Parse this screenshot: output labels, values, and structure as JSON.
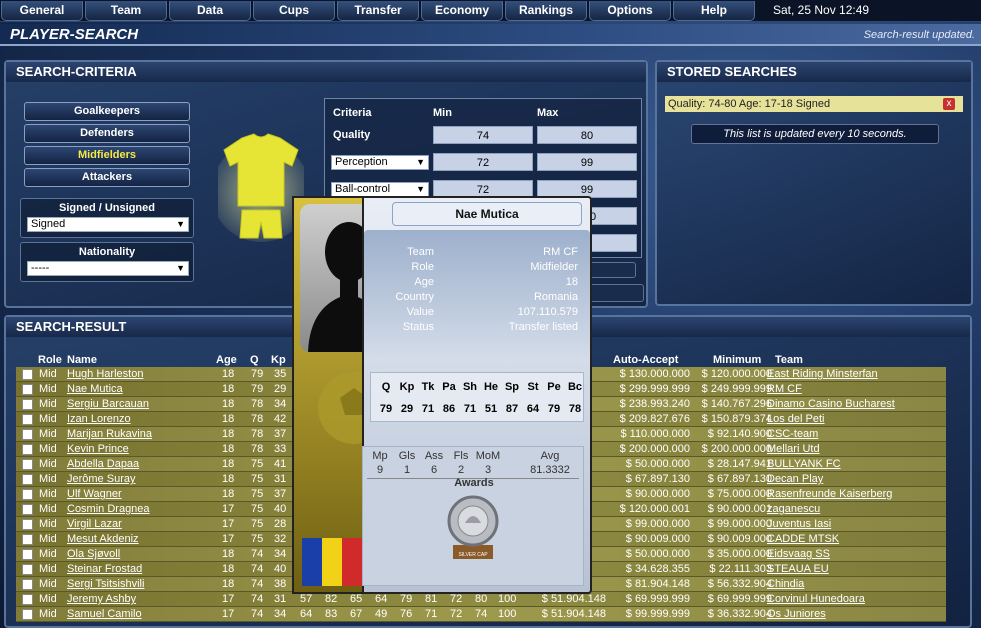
{
  "nav": {
    "items": [
      "General",
      "Team",
      "Data",
      "Cups",
      "Transfer",
      "Economy",
      "Rankings",
      "Options",
      "Help"
    ],
    "date": "Sat, 25 Nov 12:49"
  },
  "page": {
    "title": "PLAYER-SEARCH",
    "status": "Search-result updated."
  },
  "criteria": {
    "title": "SEARCH-CRITERIA",
    "positions": [
      "Goalkeepers",
      "Defenders",
      "Midfielders",
      "Attackers"
    ],
    "selected_position": "Midfielders",
    "signed_label": "Signed / Unsigned",
    "signed_value": "Signed",
    "nationality_label": "Nationality",
    "nationality_value": "-----",
    "headers": {
      "criteria": "Criteria",
      "min": "Min",
      "max": "Max"
    },
    "quality": {
      "label": "Quality",
      "min": "74",
      "max": "80"
    },
    "rows": [
      {
        "name": "Perception",
        "min": "72",
        "max": "99"
      },
      {
        "name": "Ball-control",
        "min": "72",
        "max": "99"
      }
    ],
    "hidden_value": "000"
  },
  "stored": {
    "title": "STORED SEARCHES",
    "item": "Quality: 74-80 Age: 17-18 Signed",
    "delete_icon": "x",
    "note": "This list is updated every 10 seconds."
  },
  "result": {
    "title": "SEARCH-RESULT",
    "headers": [
      "Role",
      "Name",
      "Age",
      "Q",
      "Kp",
      "Auto-Accept",
      "Minimum",
      "Team"
    ],
    "rows": [
      {
        "role": "Mid",
        "name": "Hugh Harleston",
        "age": "18",
        "q": "79",
        "kp": "35",
        "extra": [],
        "price": "",
        "auto": "$ 130.000.000",
        "min": "$ 120.000.000",
        "team": "East Riding Minsterfan"
      },
      {
        "role": "Mid",
        "name": "Nae Mutica",
        "age": "18",
        "q": "79",
        "kp": "29",
        "extra": [],
        "price": "",
        "auto": "$ 299.999.999",
        "min": "$ 249.999.999",
        "team": "RM CF"
      },
      {
        "role": "Mid",
        "name": "Sergiu Barcauan",
        "age": "18",
        "q": "78",
        "kp": "34",
        "extra": [],
        "price": "",
        "auto": "$ 238.993.240",
        "min": "$ 140.767.296",
        "team": "Dinamo Casino Bucharest"
      },
      {
        "role": "Mid",
        "name": "Izan Lorenzo",
        "age": "18",
        "q": "78",
        "kp": "42",
        "extra": [],
        "price": "",
        "auto": "$ 209.827.676",
        "min": "$ 150.879.374",
        "team": "Los del Peti"
      },
      {
        "role": "Mid",
        "name": "Marijan Rukavina",
        "age": "18",
        "q": "78",
        "kp": "37",
        "extra": [],
        "price": "",
        "auto": "$ 110.000.000",
        "min": "$ 92.140.900",
        "team": "CSC-team"
      },
      {
        "role": "Mid",
        "name": "Kevin Prince",
        "age": "18",
        "q": "78",
        "kp": "33",
        "extra": [],
        "price": "",
        "auto": "$ 200.000.000",
        "min": "$ 200.000.000",
        "team": "Mellari Utd"
      },
      {
        "role": "Mid",
        "name": "Abdella Dapaa",
        "age": "18",
        "q": "75",
        "kp": "41",
        "extra": [],
        "price": "",
        "auto": "$ 50.000.000",
        "min": "$ 28.147.941",
        "team": "BULLYANK FC"
      },
      {
        "role": "Mid",
        "name": "Jerôme Suray",
        "age": "18",
        "q": "75",
        "kp": "31",
        "extra": [],
        "price": "",
        "auto": "$ 67.897.130",
        "min": "$ 67.897.130",
        "team": "Decan Play"
      },
      {
        "role": "Mid",
        "name": "Ulf Wagner",
        "age": "18",
        "q": "75",
        "kp": "37",
        "extra": [],
        "price": "",
        "auto": "$ 90.000.000",
        "min": "$ 75.000.000",
        "team": "Rasenfreunde Kaiserberg"
      },
      {
        "role": "Mid",
        "name": "Cosmin Dragnea",
        "age": "17",
        "q": "75",
        "kp": "40",
        "extra": [],
        "price": "",
        "auto": "$ 120.000.001",
        "min": "$ 90.000.001",
        "team": "zaganescu"
      },
      {
        "role": "Mid",
        "name": "Virgil Lazar",
        "age": "17",
        "q": "75",
        "kp": "28",
        "extra": [],
        "price": "",
        "auto": "$ 99.000.000",
        "min": "$ 99.000.000",
        "team": "Juventus Iasi"
      },
      {
        "role": "Mid",
        "name": "Mesut Akdeniz",
        "age": "17",
        "q": "75",
        "kp": "32",
        "extra": [],
        "price": "",
        "auto": "$ 90.009.000",
        "min": "$ 90.009.000",
        "team": "CADDE MTSK"
      },
      {
        "role": "Mid",
        "name": "Ola Sjøvoll",
        "age": "18",
        "q": "74",
        "kp": "34",
        "extra": [],
        "price": "",
        "auto": "$ 50.000.000",
        "min": "$ 35.000.000",
        "team": "Eidsvaag SS"
      },
      {
        "role": "Mid",
        "name": "Steinar Frostad",
        "age": "18",
        "q": "74",
        "kp": "40",
        "extra": [],
        "price": "",
        "auto": "$ 34.628.355",
        "min": "$ 22.111.303",
        "team": "STEAUA EU"
      },
      {
        "role": "Mid",
        "name": "Sergi Tsitsishvili",
        "age": "18",
        "q": "74",
        "kp": "38",
        "extra": [],
        "price": "",
        "auto": "$ 81.904.148",
        "min": "$ 56.332.904",
        "team": "Chindia"
      },
      {
        "role": "Mid",
        "name": "Jeremy Ashby",
        "age": "17",
        "q": "74",
        "kp": "31",
        "extra": [
          "57",
          "82",
          "65",
          "64",
          "79",
          "81",
          "72",
          "80",
          "100"
        ],
        "price": "$ 51.904.148",
        "auto": "$ 69.999.999",
        "min": "$ 69.999.999",
        "team": "Corvinul Hunedoara"
      },
      {
        "role": "Mid",
        "name": "Samuel Camilo",
        "age": "17",
        "q": "74",
        "kp": "34",
        "extra": [
          "64",
          "83",
          "67",
          "49",
          "76",
          "71",
          "72",
          "74",
          "100"
        ],
        "price": "$ 51.904.148",
        "auto": "$ 99.999.999",
        "min": "$ 36.332.904",
        "team": "Os Juniores"
      }
    ]
  },
  "popup": {
    "name": "Nae Mutica",
    "info": [
      {
        "k": "Team",
        "v": "RM CF"
      },
      {
        "k": "Role",
        "v": "Midfielder"
      },
      {
        "k": "Age",
        "v": "18"
      },
      {
        "k": "Country",
        "v": "Romania"
      },
      {
        "k": "Value",
        "v": "107.110.579"
      },
      {
        "k": "Status",
        "v": "Transfer listed"
      }
    ],
    "skill_headers": [
      "Q",
      "Kp",
      "Tk",
      "Pa",
      "Sh",
      "He",
      "Sp",
      "St",
      "Pe",
      "Bc"
    ],
    "skill_values": [
      "79",
      "29",
      "71",
      "86",
      "71",
      "51",
      "87",
      "64",
      "79",
      "78"
    ],
    "stat_headers": [
      "Mp",
      "Gls",
      "Ass",
      "Fls",
      "MoM",
      "Avg"
    ],
    "stat_values": [
      "9",
      "1",
      "6",
      "2",
      "3",
      "81.3332"
    ],
    "awards_label": "Awards",
    "award_name": "SILVER CAP"
  },
  "colors": {
    "accent_yellow": "#f5e94a",
    "row_olive": "#8f8c42"
  }
}
